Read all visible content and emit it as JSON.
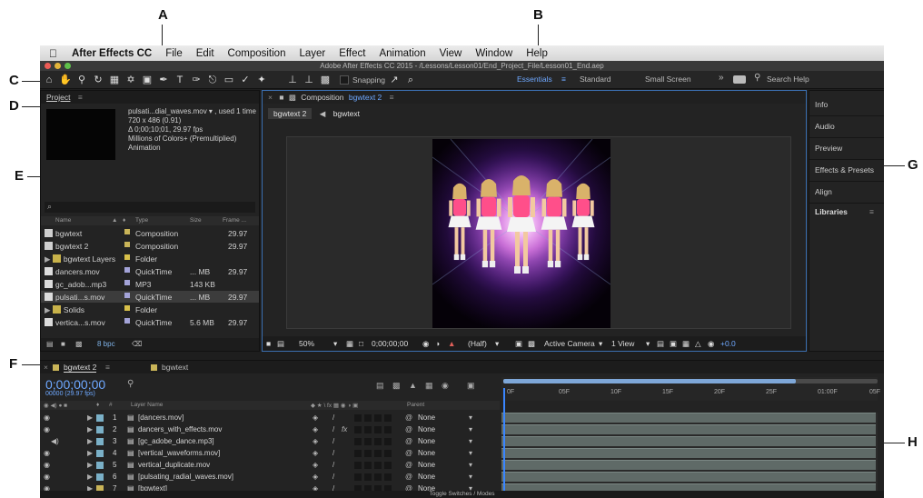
{
  "callouts": {
    "a": "A",
    "b": "B",
    "c": "C",
    "d": "D",
    "e": "E",
    "f": "F",
    "g": "G",
    "h": "H"
  },
  "menubar": {
    "app_name": "After Effects CC",
    "items": [
      "File",
      "Edit",
      "Composition",
      "Layer",
      "Effect",
      "Animation",
      "View",
      "Window",
      "Help"
    ]
  },
  "window_title": "Adobe After Effects CC 2015 - /Lessons/Lesson01/End_Project_File/Lesson01_End.aep",
  "toolbar": {
    "snapping_label": "Snapping",
    "workspaces": [
      "Essentials",
      "Standard",
      "Small Screen"
    ],
    "active_workspace": "Essentials",
    "overflow": "»",
    "search_placeholder": "Search Help"
  },
  "project": {
    "tab_label": "Project",
    "info_lines": [
      "pulsati...dial_waves.mov ▾ , used 1 time",
      "720 x 486 (0.91)",
      "Δ 0;00;10;01, 29.97 fps",
      "Millions of Colors+ (Premultiplied)",
      "Animation"
    ],
    "search_icon": "⌕",
    "columns": {
      "name": "Name",
      "type": "Type",
      "size": "Size",
      "frame": "Frame ..."
    },
    "items": [
      {
        "name": "bgwtext",
        "type": "Composition",
        "size": "",
        "frame": "29.97",
        "icon": "composition",
        "label": "#c9b458",
        "selected": false
      },
      {
        "name": "bgwtext 2",
        "type": "Composition",
        "size": "",
        "frame": "29.97",
        "icon": "composition",
        "label": "#c9b458",
        "selected": false
      },
      {
        "name": "bgwtext Layers",
        "type": "Folder",
        "size": "",
        "frame": "",
        "icon": "folder",
        "label": "#d8c04a",
        "selected": false
      },
      {
        "name": "dancers.mov",
        "type": "QuickTime",
        "size": "... MB",
        "frame": "29.97",
        "icon": "file",
        "label": "#a3a3d8",
        "selected": false
      },
      {
        "name": "gc_adob...mp3",
        "type": "MP3",
        "size": "143 KB",
        "frame": "",
        "icon": "file",
        "label": "#a3a3d8",
        "selected": false
      },
      {
        "name": "pulsati...s.mov",
        "type": "QuickTime",
        "size": "... MB",
        "frame": "29.97",
        "icon": "file",
        "label": "#a3a3d8",
        "selected": true
      },
      {
        "name": "Solids",
        "type": "Folder",
        "size": "",
        "frame": "",
        "icon": "folder",
        "label": "#d8c04a",
        "selected": false
      },
      {
        "name": "vertica...s.mov",
        "type": "QuickTime",
        "size": "5.6 MB",
        "frame": "29.97",
        "icon": "file",
        "label": "#a3a3d8",
        "selected": false
      }
    ],
    "bpc_label": "8 bpc"
  },
  "composition": {
    "panel_label": "Composition",
    "comp_name": "bgwtext 2",
    "tabs": [
      "bgwtext 2",
      "bgwtext"
    ],
    "zoom": "50%",
    "timecode": "0;00;00;00",
    "resolution": "(Half)",
    "camera": "Active Camera",
    "views": "1 View",
    "exposure": "+0.0"
  },
  "right_panels": [
    "Info",
    "Audio",
    "Preview",
    "Effects & Presets",
    "Align",
    "Libraries"
  ],
  "timeline": {
    "tabs": [
      "bgwtext 2",
      "bgwtext"
    ],
    "timecode": "0;00;00;00",
    "fps": "00000 (29.97 fps)",
    "col_layer_name": "Layer Name",
    "col_parent": "Parent",
    "ruler_labels": [
      "0F",
      "05F",
      "10F",
      "15F",
      "20F",
      "25F",
      "01:00F",
      "05F"
    ],
    "layers": [
      {
        "num": "1",
        "name": "[dancers.mov]",
        "parent": "None",
        "fx": false,
        "color": "#7ab0c7"
      },
      {
        "num": "2",
        "name": "dancers_with_effects.mov",
        "parent": "None",
        "fx": true,
        "color": "#7ab0c7"
      },
      {
        "num": "3",
        "name": "[gc_adobe_dance.mp3]",
        "parent": "None",
        "fx": false,
        "color": "#7ab0c7"
      },
      {
        "num": "4",
        "name": "[vertical_waveforms.mov]",
        "parent": "None",
        "fx": false,
        "color": "#7ab0c7"
      },
      {
        "num": "5",
        "name": "vertical_duplicate.mov",
        "parent": "None",
        "fx": false,
        "color": "#7ab0c7"
      },
      {
        "num": "6",
        "name": "[pulsating_radial_waves.mov]",
        "parent": "None",
        "fx": false,
        "color": "#7ab0c7"
      },
      {
        "num": "7",
        "name": "[bgwtext]",
        "parent": "None",
        "fx": false,
        "color": "#c9b458"
      }
    ],
    "footer": "Toggle Switches / Modes"
  }
}
